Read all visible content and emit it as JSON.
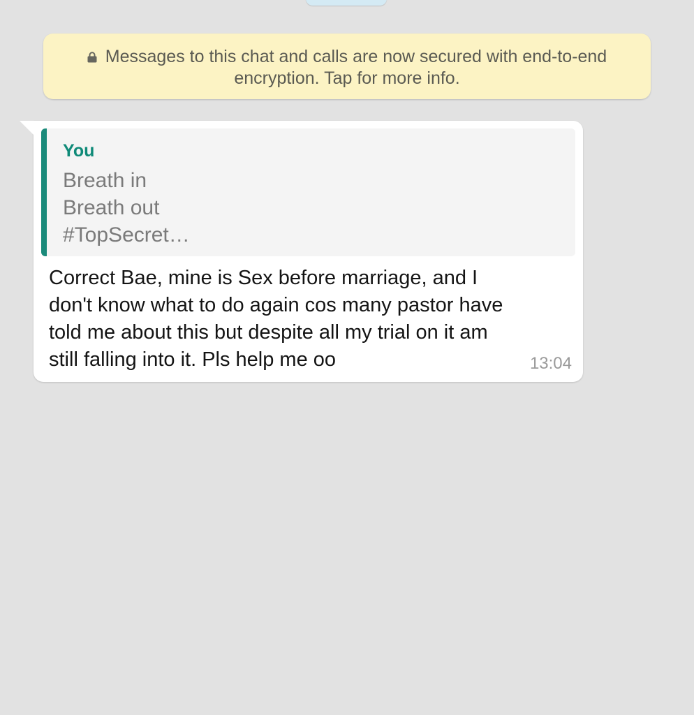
{
  "banner": {
    "icon": "lock-icon",
    "lines": [
      "Messages to this chat and calls are now secured with end-to-end",
      "encryption. Tap for more info."
    ]
  },
  "message": {
    "quote": {
      "author": "You",
      "author_color": "#0f8a78",
      "lines": [
        "Breath in",
        "Breath out",
        "#TopSecret…"
      ]
    },
    "lines": [
      "Correct Bae, mine is Sex before marriage, and I",
      "don't know what to do again cos many pastor have",
      "told me about this but despite all my trial on it am",
      "still falling into it. Pls help me oo"
    ],
    "time": "13:04"
  },
  "colors": {
    "background": "#e2e2e2",
    "banner_bg": "#fcf3c4",
    "bubble_bg": "#ffffff",
    "quote_bar": "#1a8a7a"
  }
}
